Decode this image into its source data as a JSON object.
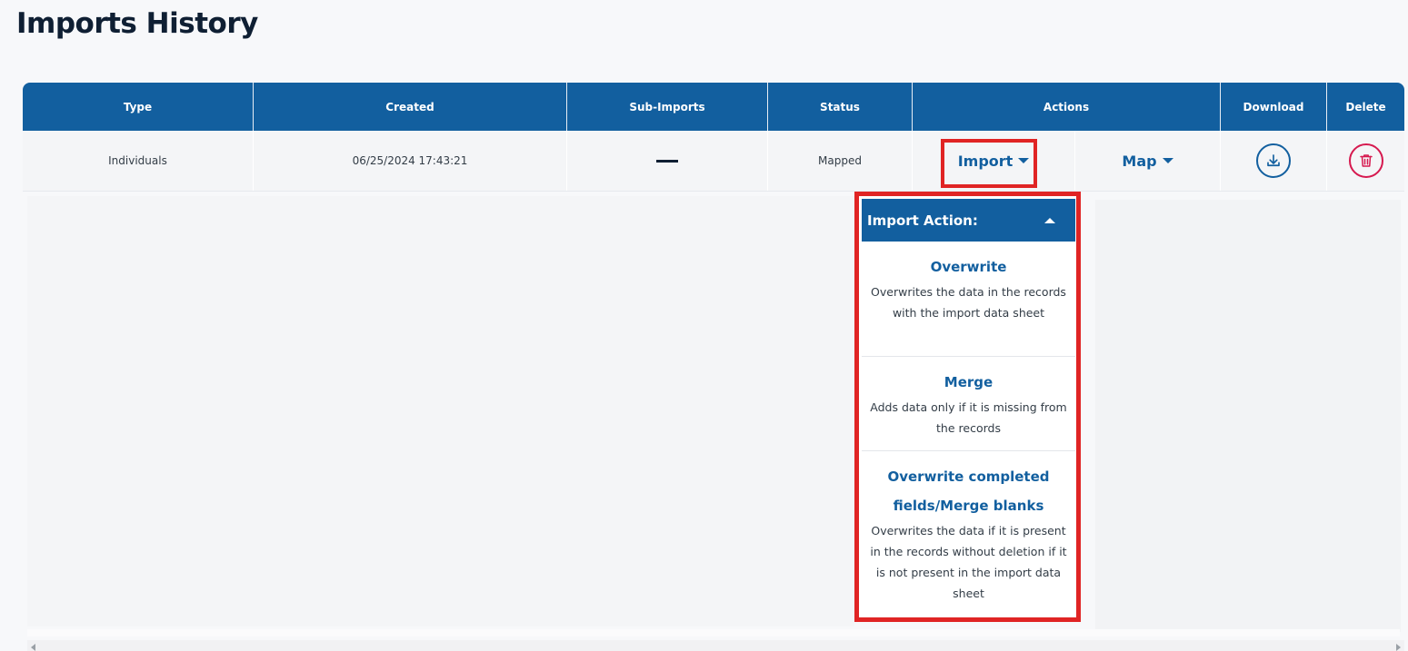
{
  "page": {
    "title": "Imports History"
  },
  "table": {
    "headers": {
      "type": "Type",
      "created": "Created",
      "sub_imports": "Sub-Imports",
      "status": "Status",
      "actions": "Actions",
      "download": "Download",
      "delete": "Delete"
    },
    "rows": [
      {
        "type": "Individuals",
        "created": "06/25/2024 17:43:21",
        "status": "Mapped",
        "import_label": "Import",
        "map_label": "Map"
      }
    ]
  },
  "icons": {
    "download": "download-icon",
    "delete": "trash-icon",
    "dash": "dash-icon"
  },
  "import_dropdown": {
    "header": "Import Action:",
    "options": [
      {
        "title": "Overwrite",
        "description": "Overwrites the data in the records with the import data sheet"
      },
      {
        "title": "Merge",
        "description": "Adds data only if it is missing from the records"
      },
      {
        "title": "Overwrite completed fields/Merge blanks",
        "description": "Overwrites the data if it is present in the records without deletion if it is not present in the import data sheet"
      }
    ]
  },
  "colors": {
    "header_blue": "#125f9f",
    "highlight_red": "#e02424",
    "delete_pink": "#d6194f"
  }
}
